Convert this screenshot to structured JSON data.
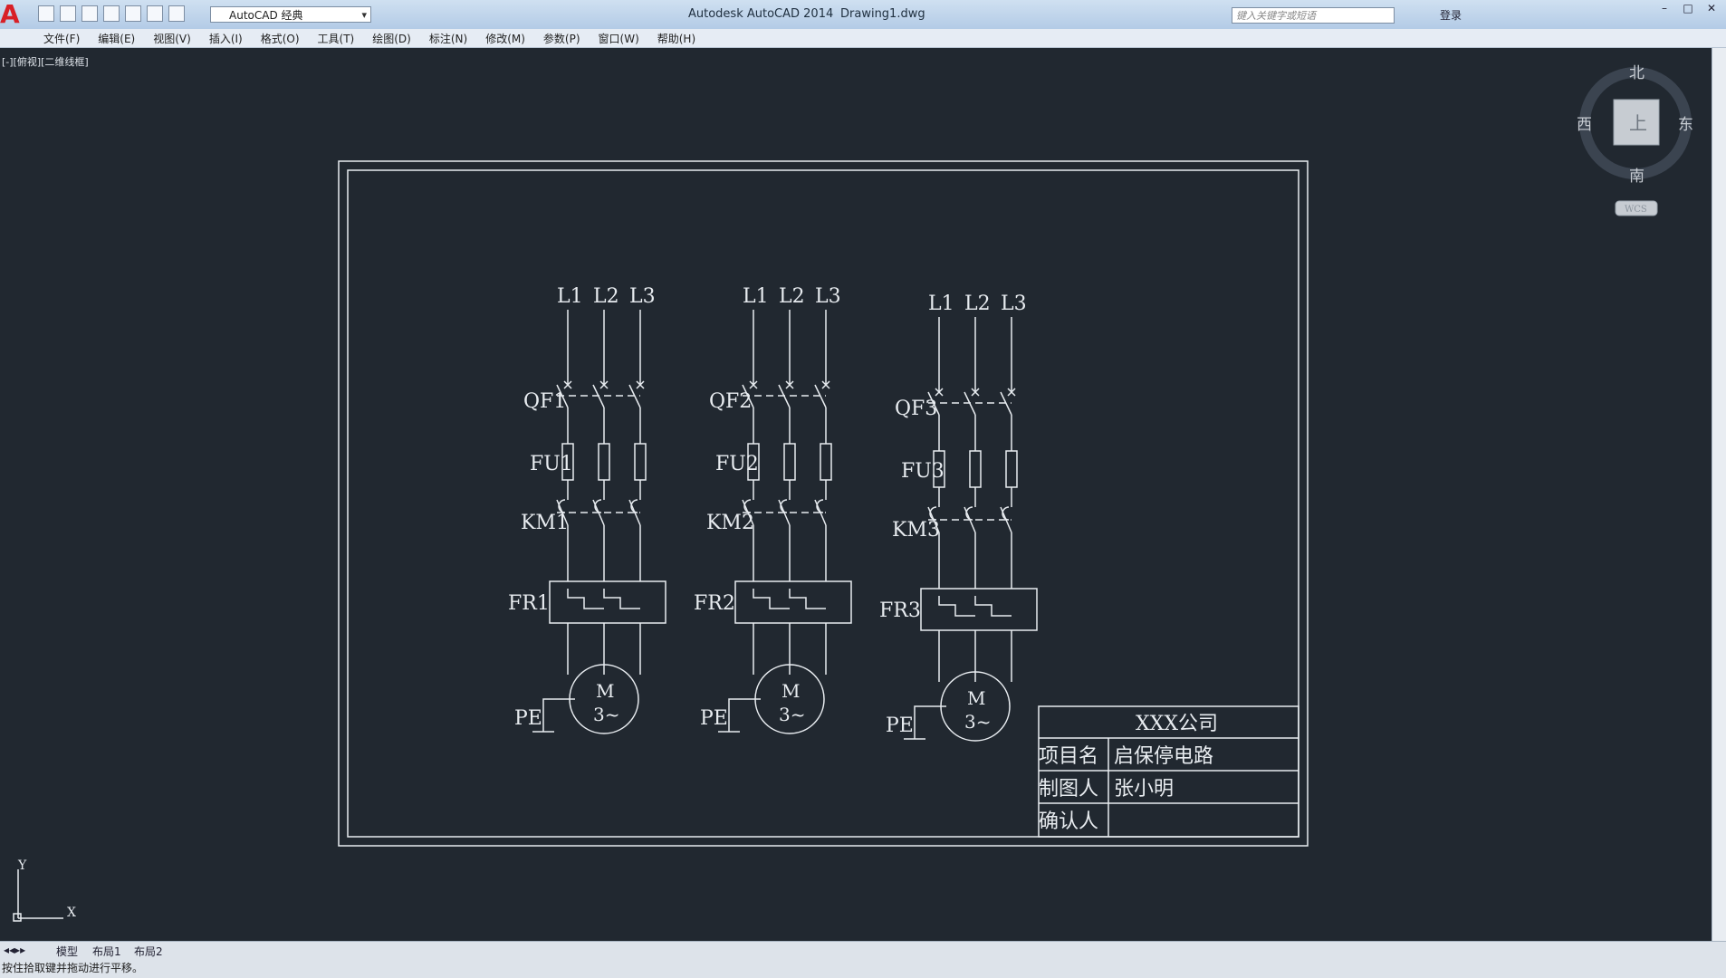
{
  "app": {
    "title": "Autodesk AutoCAD 2014",
    "document": "Drawing1.dwg",
    "workspace": "AutoCAD 经典",
    "search_placeholder": "键入关键字或短语",
    "login": "登录"
  },
  "menu": [
    "文件(F)",
    "编辑(E)",
    "视图(V)",
    "插入(I)",
    "格式(O)",
    "工具(T)",
    "绘图(D)",
    "标注(N)",
    "修改(M)",
    "参数(P)",
    "窗口(W)",
    "帮助(H)"
  ],
  "viewport_label": "[-][俯视][二维线框]",
  "viewcube": {
    "north": "北",
    "south": "南",
    "east": "东",
    "west": "西",
    "top": "上",
    "wcs": "WCS"
  },
  "ucs": {
    "x": "X",
    "y": "Y"
  },
  "drawing": {
    "circuits": [
      {
        "lines": [
          "L1",
          "L2",
          "L3"
        ],
        "breaker": "QF1",
        "fuse": "FU1",
        "contactor": "KM1",
        "relay": "FR1",
        "motor": "M",
        "motor_phase": "3~",
        "ground": "PE"
      },
      {
        "lines": [
          "L1",
          "L2",
          "L3"
        ],
        "breaker": "QF2",
        "fuse": "FU2",
        "contactor": "KM2",
        "relay": "FR2",
        "motor": "M",
        "motor_phase": "3~",
        "ground": "PE"
      },
      {
        "lines": [
          "L1",
          "L2",
          "L3"
        ],
        "breaker": "QF3",
        "fuse": "FU3",
        "contactor": "KM3",
        "relay": "FR3",
        "motor": "M",
        "motor_phase": "3~",
        "ground": "PE"
      }
    ],
    "title_block": {
      "company": "XXX公司",
      "project_label": "项目名",
      "project_value": "启保停电路",
      "drafter_label": "制图人",
      "drafter_value": "张小明",
      "approver_label": "确认人",
      "approver_value": ""
    }
  },
  "tabs": [
    "模型",
    "布局1",
    "布局2"
  ],
  "status": "按住拾取键并拖动进行平移。",
  "colors": {
    "background": "#212830",
    "lines": "#e8ecf0"
  }
}
